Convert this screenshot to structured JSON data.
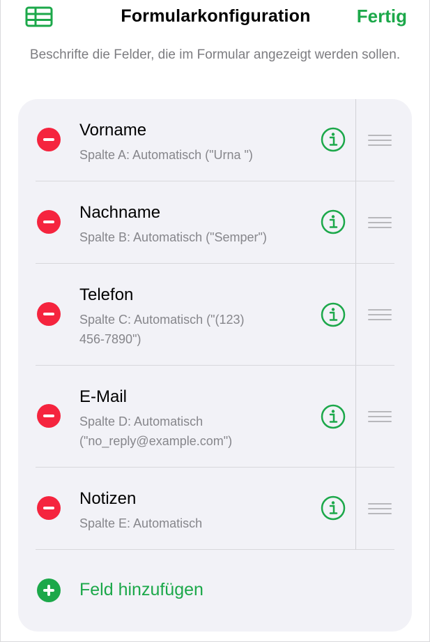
{
  "header": {
    "title": "Formularkonfiguration",
    "done_label": "Fertig",
    "table_icon": "table-grid-icon"
  },
  "subtitle": "Beschrifte die Felder, die im Formular angezeigt werden sollen.",
  "fields": [
    {
      "name": "Vorname",
      "desc_lines": [
        "Spalte A: Automatisch (\"Urna \")"
      ]
    },
    {
      "name": "Nachname",
      "desc_lines": [
        "Spalte B: Automatisch (\"Semper\")"
      ]
    },
    {
      "name": "Telefon",
      "desc_lines": [
        "Spalte C: Automatisch (\"(123)",
        "456-7890\")"
      ]
    },
    {
      "name": "E-Mail",
      "desc_lines": [
        "Spalte D: Automatisch",
        "(\"no_reply@example.com\")"
      ]
    },
    {
      "name": "Notizen",
      "desc_lines": [
        "Spalte E: Automatisch"
      ]
    }
  ],
  "add_field_label": "Feld hinzufügen",
  "colors": {
    "accent_green": "#1ca84a",
    "delete_red": "#f5243e",
    "card_bg": "#f2f2f7",
    "secondary_text": "#86868b"
  }
}
